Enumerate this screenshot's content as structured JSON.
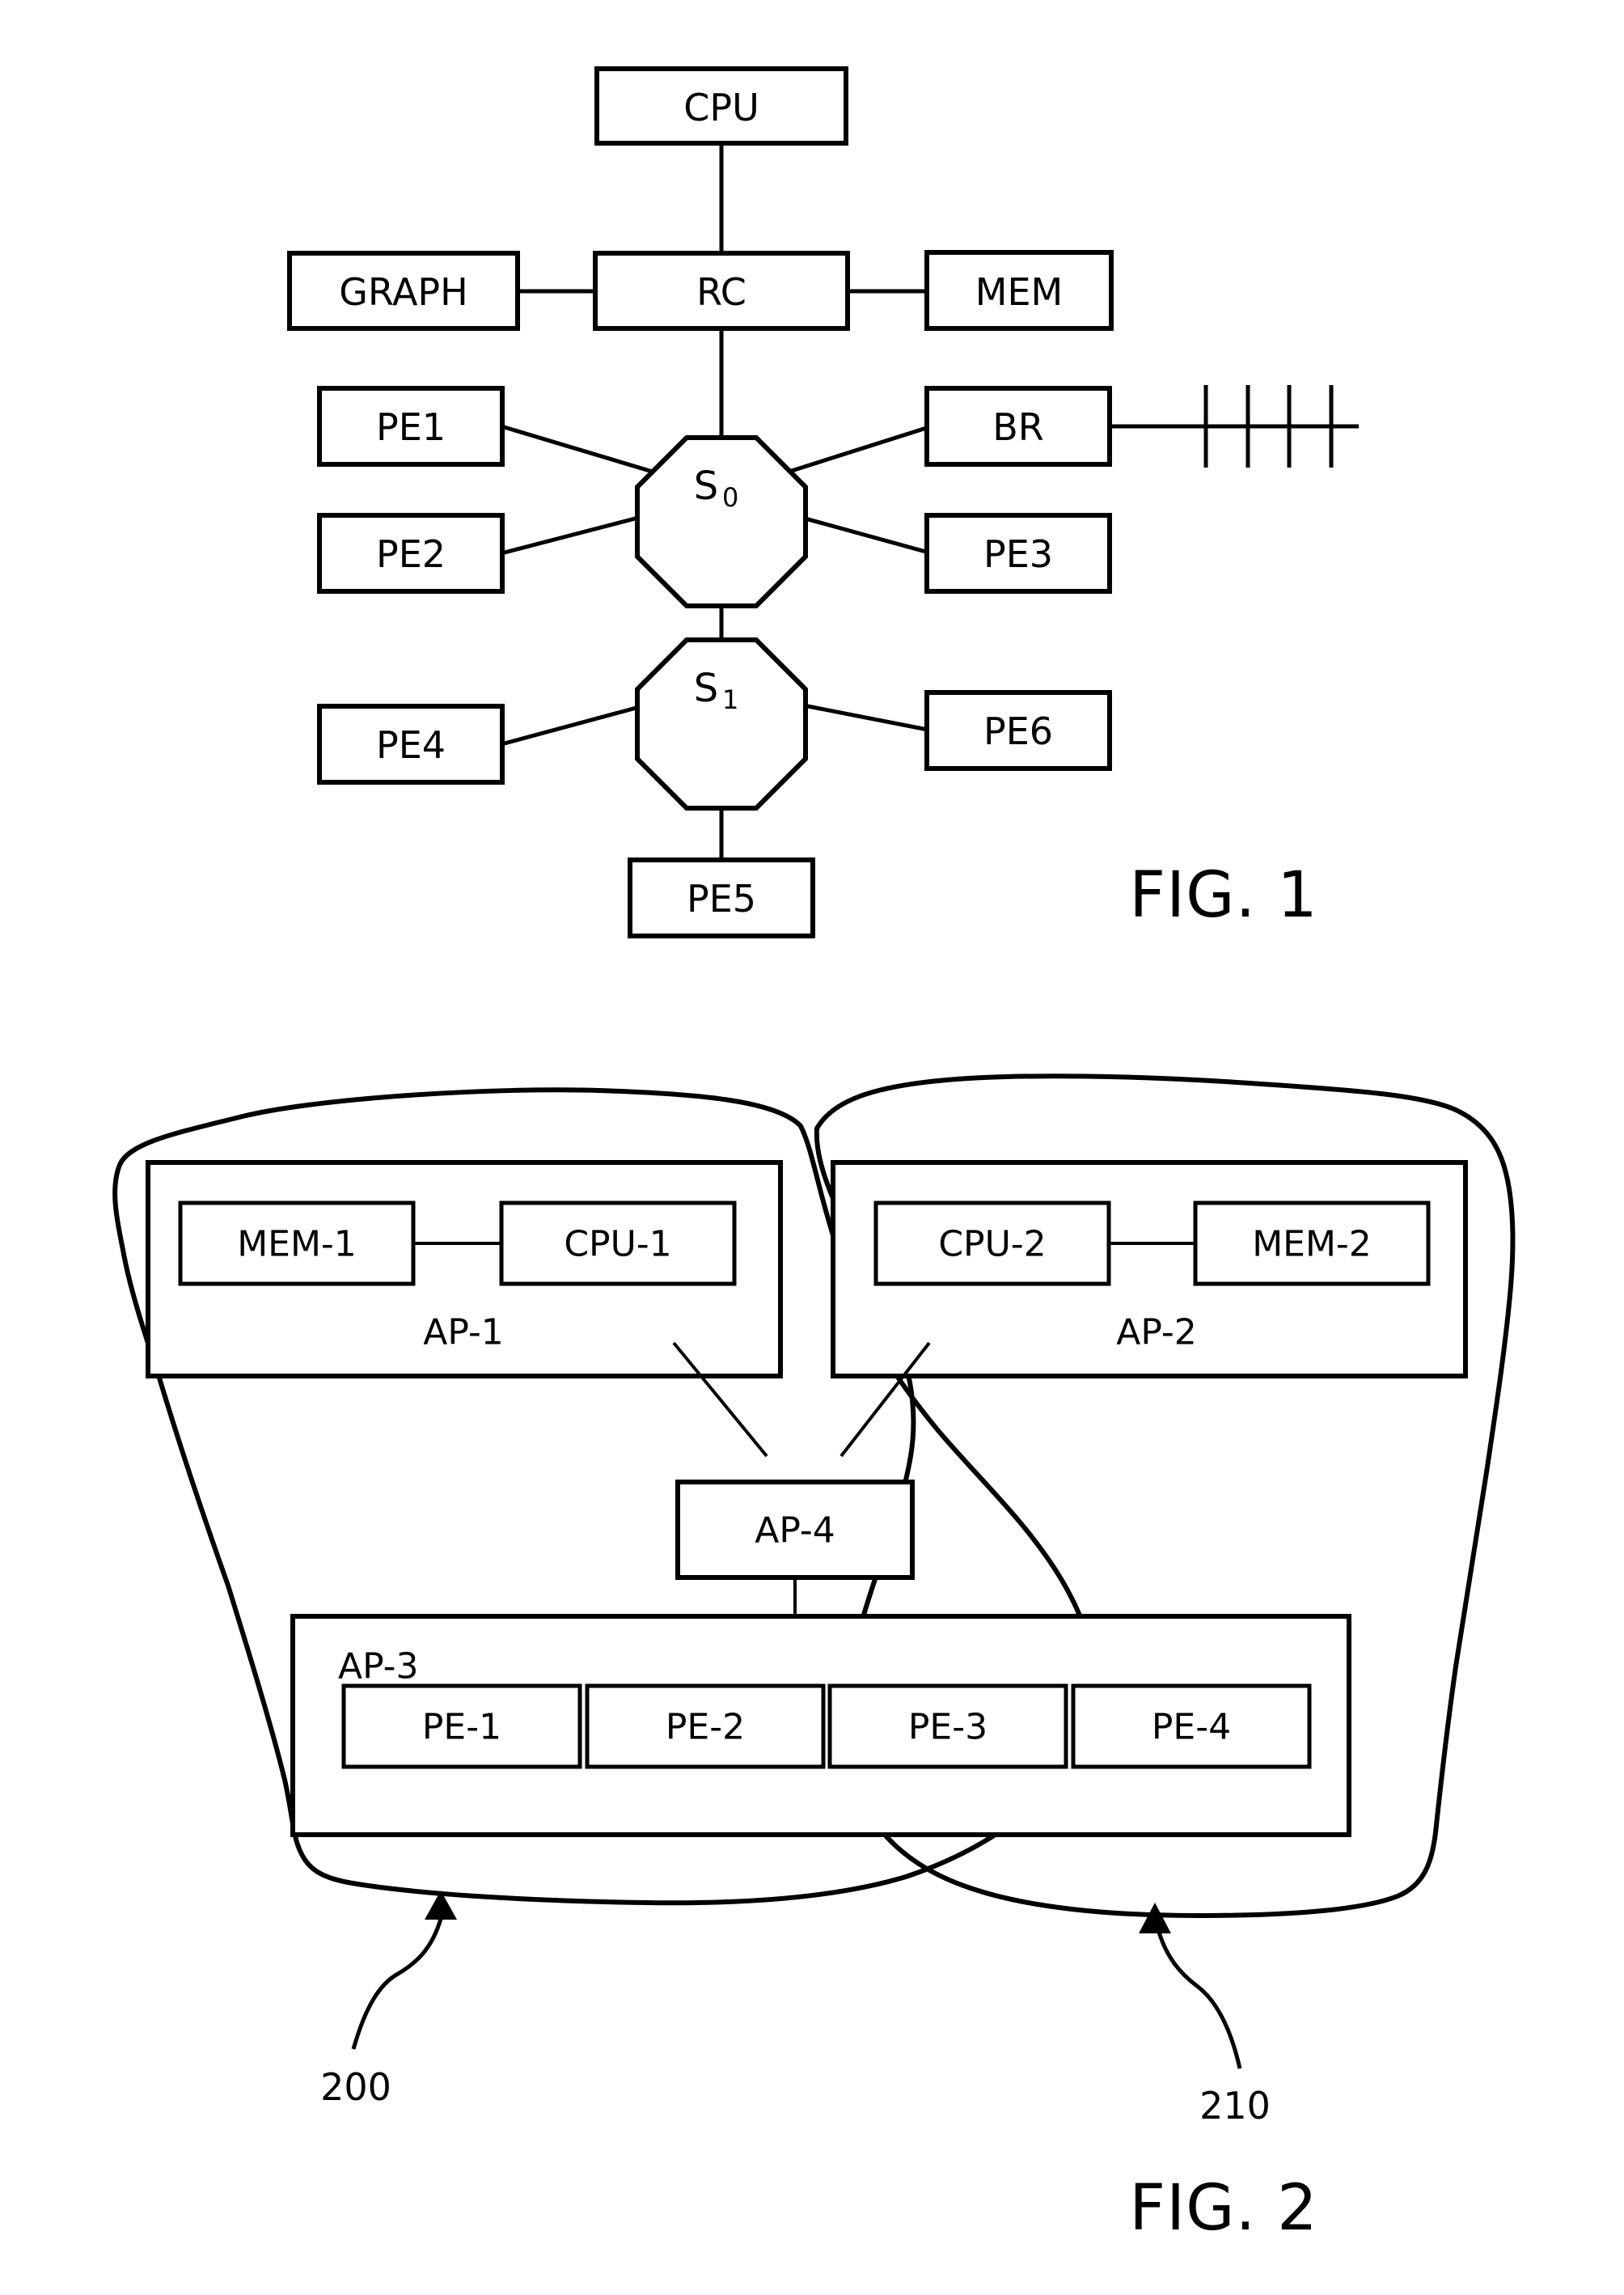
{
  "figures": [
    {
      "id": "fig1",
      "caption": "FIG. 1",
      "nodes": {
        "cpu": "CPU",
        "graph": "GRAPH",
        "rc": "RC",
        "mem": "MEM",
        "pe1": "PE1",
        "pe2": "PE2",
        "pe3": "PE3",
        "pe4": "PE4",
        "pe5": "PE5",
        "pe6": "PE6",
        "br": "BR",
        "s0_base": "S",
        "s0_sub": "0",
        "s1_base": "S",
        "s1_sub": "1"
      }
    },
    {
      "id": "fig2",
      "caption": "FIG. 2",
      "groups": {
        "ap1": "AP-1",
        "ap2": "AP-2",
        "ap3": "AP-3",
        "ap4": "AP-4"
      },
      "nodes": {
        "mem1": "MEM-1",
        "cpu1": "CPU-1",
        "cpu2": "CPU-2",
        "mem2": "MEM-2",
        "pe_1": "PE-1",
        "pe_2": "PE-2",
        "pe_3": "PE-3",
        "pe_4": "PE-4"
      },
      "refs": {
        "left": "200",
        "right": "210"
      }
    }
  ],
  "colors": {
    "ink": "#000000",
    "paper": "#ffffff"
  }
}
